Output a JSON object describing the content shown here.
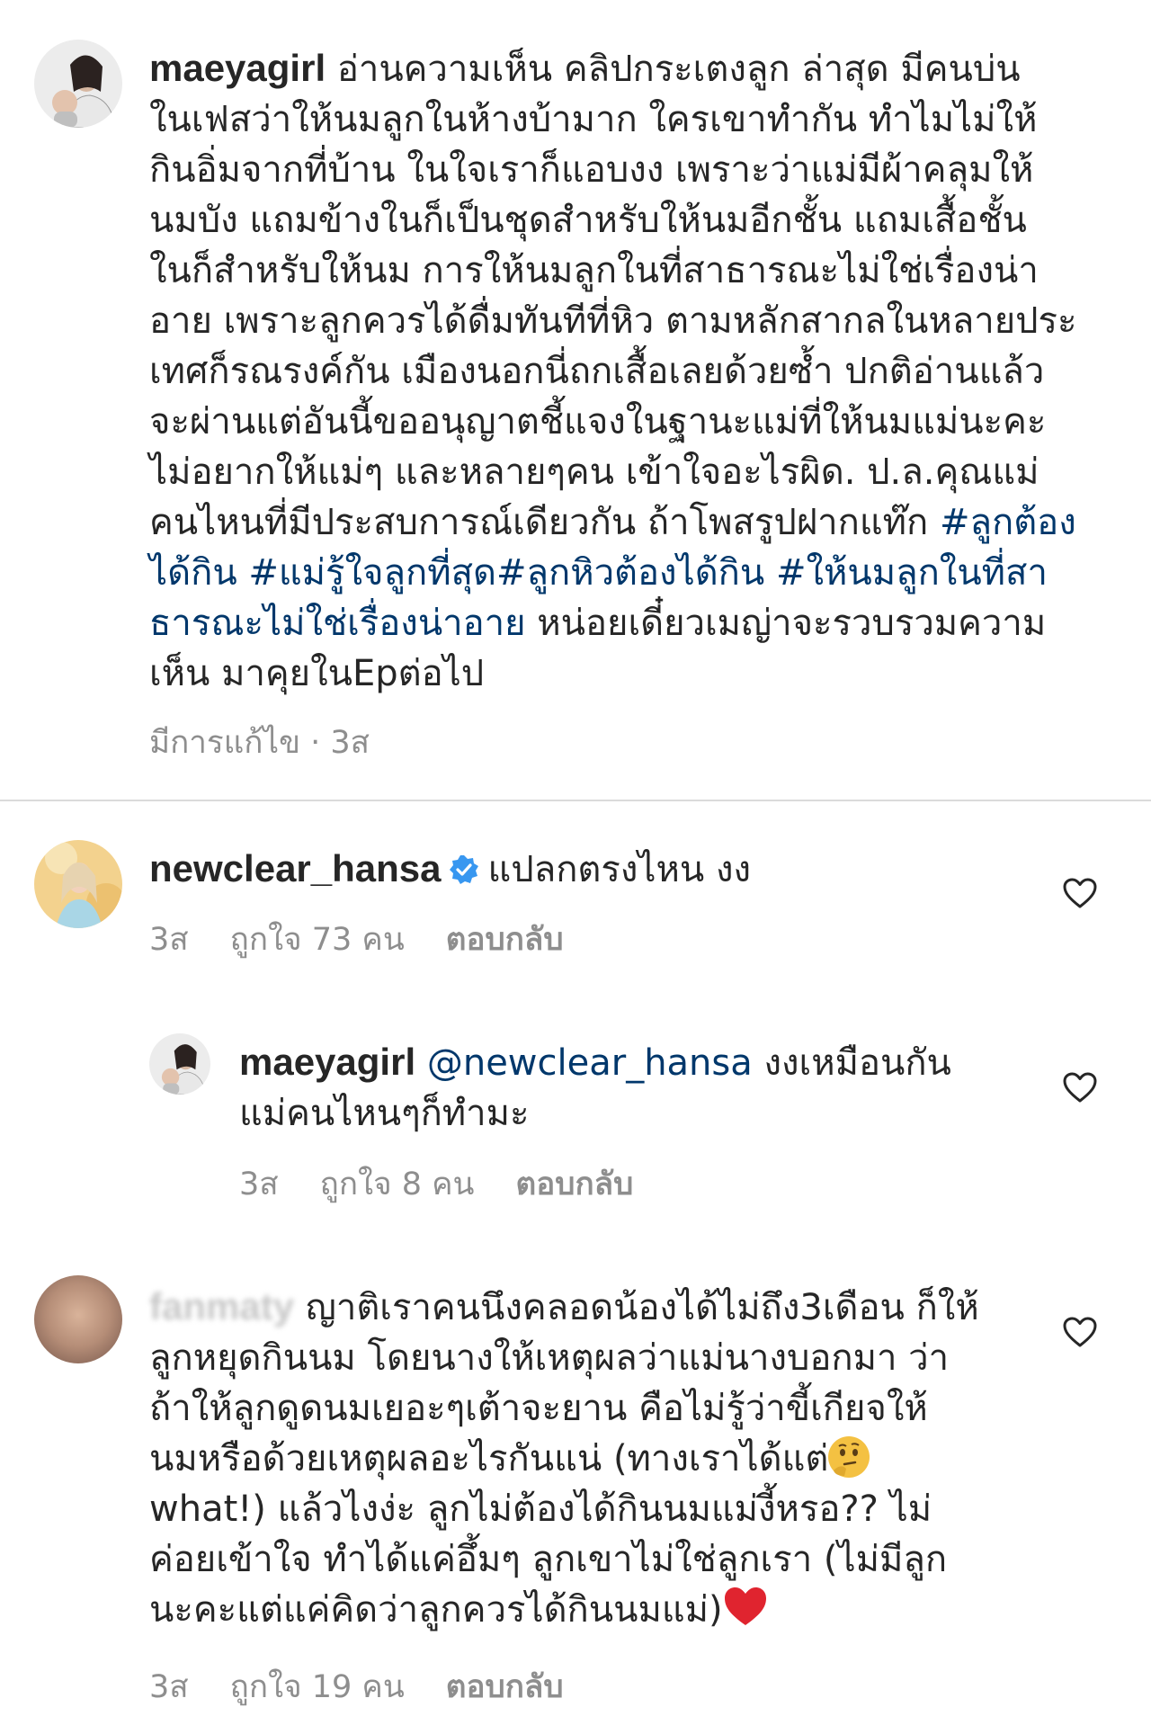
{
  "post_caption": {
    "username": "maeyagirl",
    "lines": [
      "อ่านความเห็น คลิปกระเตงลูก ล่าสุด มีคนบ่น",
      "ในเฟสว่าให้นมลูกในห้างบ้ามาก ใครเขาทำกัน ทำไมไม่ให้",
      "กินอิ่มจากที่บ้าน ในใจเราก็แอบงง เพราะว่าแม่มีผ้าคลุมให้",
      "นมบัง แถมข้างในก็เป็นชุดสำหรับให้นมอีกชั้น แถมเสื้อชั้น",
      "ในก็สำหรับให้นม  การให้นมลูกในที่สาธารณะไม่ใช่เรื่องน่า",
      "อาย เพราะลูกควรได้ดื่มทันทีที่หิว  ตามหลักสากลในหลายประ",
      "เทศก็รณรงค์กัน เมืองนอกนี่ถกเสื้อเลยด้วยซ้ำ  ปกติอ่านแล้ว",
      "จะผ่านแต่อันนี้ขออนุญาตชี้แจงในฐานะแม่ที่ให้นมแม่นะคะ",
      "ไม่อยากให้แม่ๆ และหลายๆคน เข้าใจอะไรผิด. ป.ล.คุณแม่"
    ],
    "line10_text": "คนไหนที่มีประสบการณ์เดียวกัน ถ้าโพสรูปฝากแท๊ก ",
    "line10_tag": "#ลูกต้อง",
    "line11_tag": "ได้กิน #แม่รู้ใจลูกที่สุด#ลูกหิวต้องได้กิน #ให้นมลูกในที่สา",
    "line12_tag": "ธารณะไม่ใช่เรื่องน่าอาย",
    "line12_text": " หน่อยเดี๋ยวเมญ่าจะรวบรวมความ",
    "line13_text": "เห็น มาคุยในEpต่อไป",
    "meta_edited": "มีการแก้ไข · 3ส"
  },
  "comments": [
    {
      "username": "newclear_hansa",
      "text": "แปลกตรงไหน งง",
      "time": "3ส",
      "likes": "ถูกใจ 73 คน",
      "reply_label": "ตอบกลับ"
    },
    {
      "username": "maeyagirl",
      "mention": "@newclear_hansa",
      "line1_text": " งงเหมือนกัน",
      "line2_text": "แม่คนไหนๆก็ทำมะ",
      "time": "3ส",
      "likes": "ถูกใจ 8 คน",
      "reply_label": "ตอบกลับ"
    },
    {
      "username": "fanmaty",
      "line1_text": " ญาติเราคนนึงคลอดน้องได้ไม่ถึง3เดือน ก็ให้",
      "lines": [
        "ลูกหยุดกินนม โดยนางให้เหตุผลว่าแม่นางบอกมา ว่า",
        "ถ้าให้ลูกดูดนมเยอะๆเต้าจะยาน คือไม่รู้ว่าขี้เกียจให้"
      ],
      "line4_text": "นมหรือด้วยเหตุผลอะไรกันแน่ (ทางเราได้แต่",
      "line5_text": "what!) แล้วไงง่ะ ลูกไม่ต้องได้กินนมแม่งี้หรอ?? ไม่",
      "line6_text": "ค่อยเข้าใจ ทำได้แค่อึ้มๆ ลูกเขาไม่ใช่ลูกเรา (ไม่มีลูก",
      "line7_text": "นะคะแต่แค่คิดว่าลูกควรได้กินนมแม่)",
      "time": "3ส",
      "likes": "ถูกใจ 19 คน",
      "reply_label": "ตอบกลับ"
    }
  ],
  "icons": {
    "heart": "heart-outline-icon",
    "verified": "verified-badge-icon",
    "thinking": "thinking-face-emoji",
    "red_heart": "red-heart-emoji"
  },
  "colors": {
    "text": "#262626",
    "link": "#00376b",
    "meta": "#8e8e8e",
    "verified": "#3897f0",
    "divider": "#dbdbdb"
  }
}
